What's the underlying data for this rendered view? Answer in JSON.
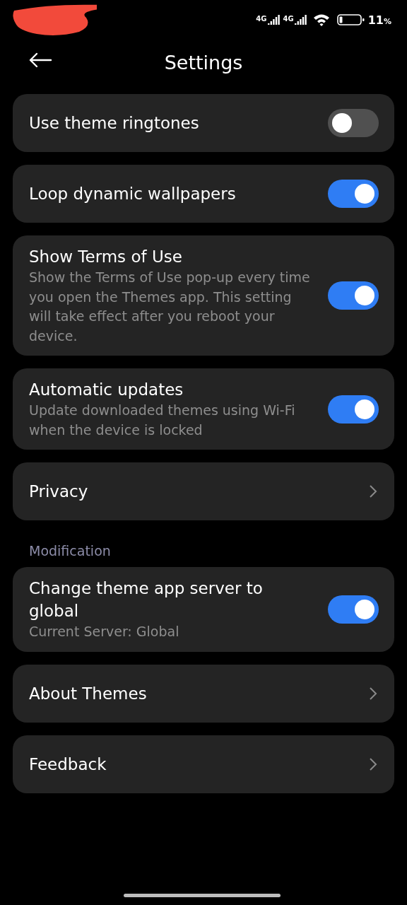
{
  "status_bar": {
    "network_labels": [
      "4G",
      "4G"
    ],
    "battery": "11",
    "battery_unit": "%"
  },
  "header": {
    "title": "Settings"
  },
  "items": [
    {
      "kind": "toggle",
      "title": "Use theme ringtones",
      "on": false
    },
    {
      "kind": "toggle",
      "title": "Loop dynamic wallpapers",
      "on": true
    },
    {
      "kind": "toggle",
      "title": "Show Terms of Use",
      "description": "Show the Terms of Use pop-up every time you open the Themes app. This setting will take effect after you reboot your device.",
      "on": true
    },
    {
      "kind": "toggle",
      "title": "Automatic updates",
      "description": "Update downloaded themes using Wi-Fi when the device is locked",
      "on": true
    },
    {
      "kind": "link",
      "title": "Privacy"
    },
    {
      "kind": "section",
      "title": "Modification"
    },
    {
      "kind": "toggle",
      "title": "Change theme app server to global",
      "description": "Current Server: Global",
      "on": true
    },
    {
      "kind": "link",
      "title": "About Themes"
    },
    {
      "kind": "link",
      "title": "Feedback"
    }
  ]
}
